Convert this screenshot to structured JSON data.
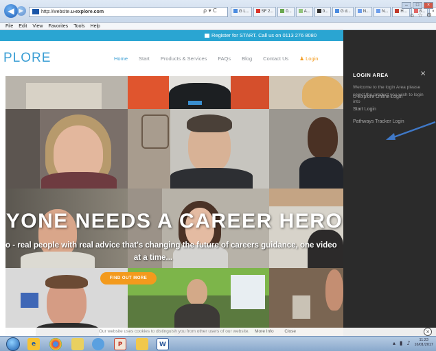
{
  "browser": {
    "url_prefix": "http://website.",
    "url_domain": "u-explore.com",
    "back_icon": "back-arrow-icon",
    "forward_icon": "forward-arrow-icon",
    "search_controls": "ρ ▾ C",
    "tabs": [
      "G L...",
      "SF 2...",
      "0...",
      "A...",
      "0...",
      "G d...",
      "N...",
      "N...",
      "H...",
      "8...",
      "×"
    ],
    "menu": [
      "File",
      "Edit",
      "View",
      "Favorites",
      "Tools",
      "Help"
    ],
    "window_controls": [
      "–",
      "□",
      "×"
    ]
  },
  "site": {
    "topbar_text": "Register for START. Call us on 0113 276 8080",
    "logo": "PLORE",
    "nav": [
      "Home",
      "Start",
      "Products & Services",
      "FAQs",
      "Blog",
      "Contact Us"
    ],
    "nav_login": "Login",
    "headline": "YONE NEEDS A CAREER HERO",
    "subline_1": "o - real people with real advice that's changing the future of careers guidance, one video",
    "subline_2": "at a time...",
    "cta": "FIND OUT MORE"
  },
  "login_panel": {
    "title": "LOGIN AREA",
    "close": "×",
    "welcome": "Welcome to the login Area please select the product you wish to login into",
    "links": [
      "U-Explore Online Login",
      "Start Login",
      "Pathways Tracker Login"
    ]
  },
  "cookie_bar": {
    "text": "Our website uses cookies to distinguish you from other users of our website.",
    "more_info": "More Info",
    "close": "Close"
  },
  "taskbar": {
    "clock_time": "11:23",
    "clock_date": "16/01/2017",
    "apps": [
      "ie-icon",
      "chrome-icon",
      "explorer-icon",
      "word-icon",
      "folder-icon",
      "paint-icon",
      "firefox-icon"
    ]
  },
  "colors": {
    "accent": "#2aa5d2",
    "logo": "#3a9ed4",
    "cta": "#f39a1d",
    "panel": "#2b2b2b"
  }
}
